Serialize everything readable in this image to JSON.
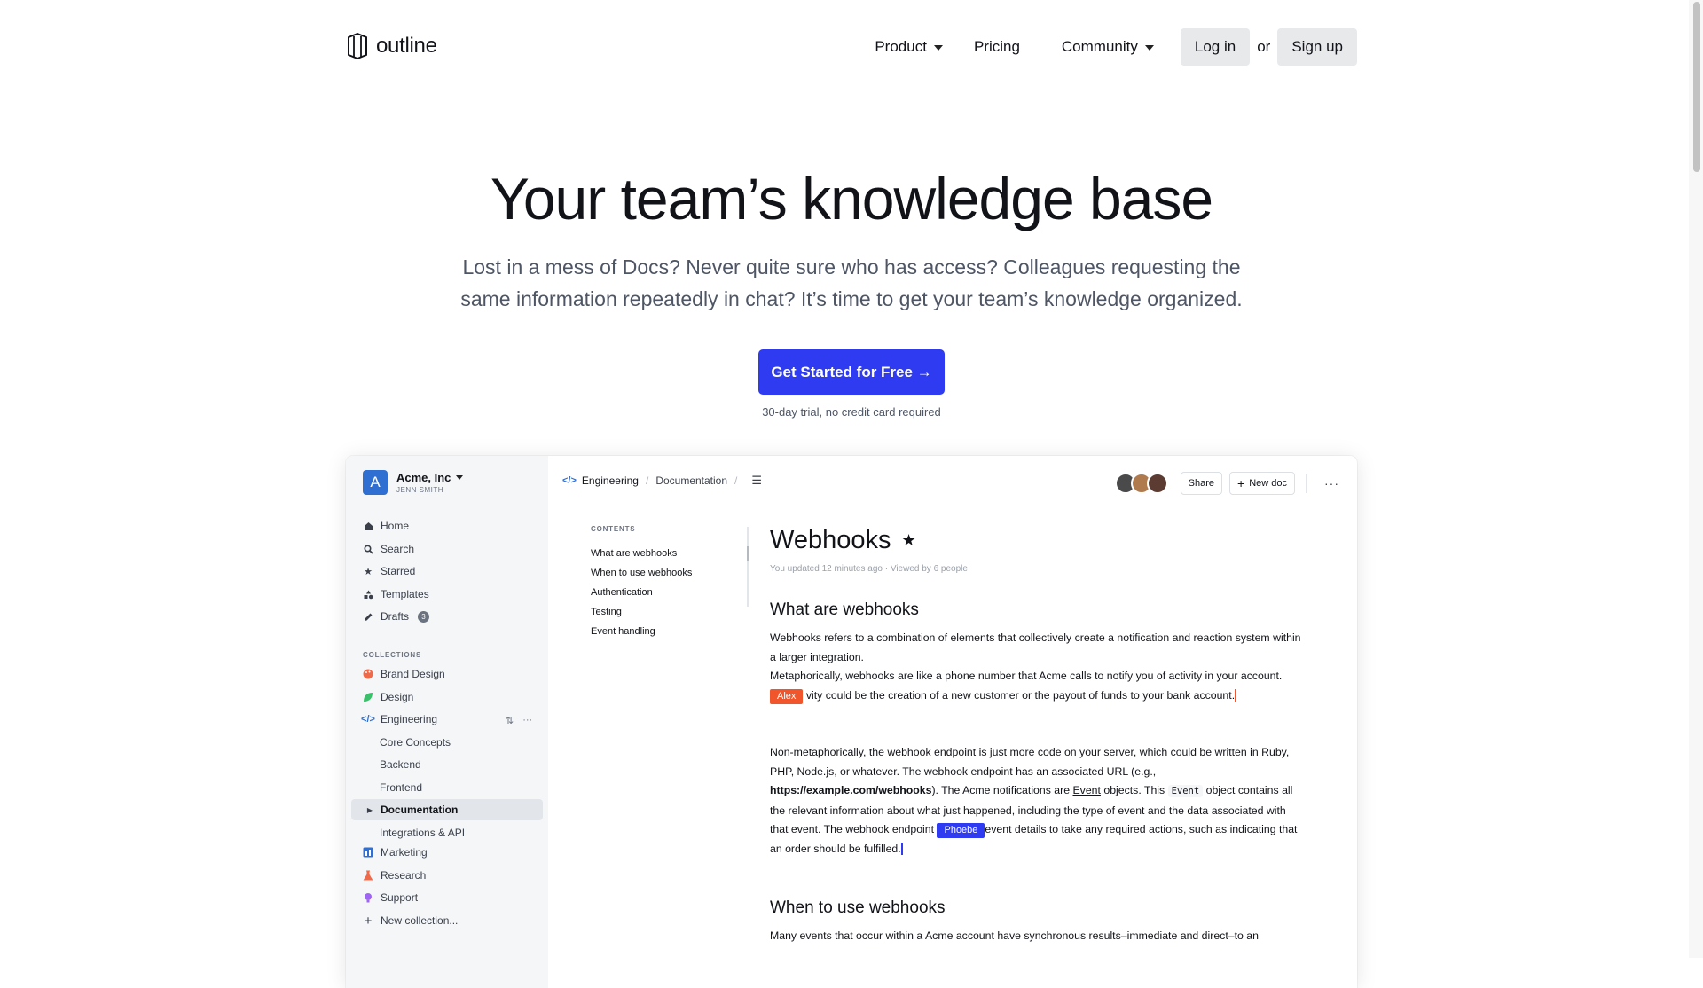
{
  "brand": {
    "name": "outline"
  },
  "nav": {
    "product": "Product",
    "pricing": "Pricing",
    "community": "Community",
    "login": "Log in",
    "or": "or",
    "signup": "Sign up"
  },
  "hero": {
    "title": "Your team’s knowledge base",
    "subtitle_line1": "Lost in a mess of Docs? Never quite sure who has access? Colleagues requesting the",
    "subtitle_line2": "same information repeatedly in chat? It’s time to get your team’s knowledge organized.",
    "cta": "Get Started for Free →",
    "cta_note": "30-day trial, no credit card required"
  },
  "app": {
    "team": {
      "avatar_letter": "A",
      "name": "Acme, Inc",
      "user": "JENN SMITH"
    },
    "sidebar": {
      "nav": [
        "Home",
        "Search",
        "Starred",
        "Templates",
        "Drafts"
      ],
      "drafts_count": "3",
      "collections_heading": "COLLECTIONS",
      "collections": [
        "Brand Design",
        "Design",
        "Engineering"
      ],
      "engineering_children": [
        "Core Concepts",
        "Backend",
        "Frontend",
        "Documentation",
        "Integrations & API"
      ],
      "more_collections": [
        "Marketing",
        "Research",
        "Support"
      ],
      "new_collection": "New collection..."
    },
    "breadcrumb": {
      "collection": "Engineering",
      "section": "Documentation"
    },
    "toolbar": {
      "share": "Share",
      "new_doc": "New doc"
    },
    "toc": {
      "heading": "CONTENTS",
      "items": [
        "What are webhooks",
        "When to use webhooks",
        "Authentication",
        "Testing",
        "Event handling"
      ]
    },
    "doc": {
      "title": "Webhooks",
      "meta": "You updated 12 minutes ago · Viewed by 6 people",
      "h2_1": "What are webhooks",
      "p1": "Webhooks refers to a combination of elements that collectively create a notification and reaction system within a larger integration.",
      "p2_a": "Metaphorically, webhooks are like a phone number that Acme calls to notify you of activity in your account.",
      "p2_b": "vity could be the creation of a new customer or the payout of funds to your bank account.",
      "cursor_alex": "Alex",
      "p3_a": "Non-metaphorically, the webhook endpoint is just more code on your server, which could be written in Ruby, PHP, Node.js, or whatever. The webhook endpoint has an associated URL (e.g.,",
      "p3_url": "https://example.com/webhooks",
      "p3_b": "). The Acme notifications are",
      "p3_event": "Event",
      "p3_c": "objects. This",
      "p3_code": "Event",
      "p3_d": "object contains all the relevant information about what just happened, including the type of event and the data associated with that event. The webhook endpoint",
      "cursor_phoebe": "Phoebe",
      "p3_e": "event details to take any required actions, such as indicating that an order should be fulfilled.",
      "h2_2": "When to use webhooks",
      "p4": "Many events that occur within a Acme account have synchronous results–immediate and direct–to an"
    }
  },
  "colors": {
    "accent": "#2e3bf1",
    "alex": "#f1552b",
    "phoebe": "#2e3bf1"
  }
}
